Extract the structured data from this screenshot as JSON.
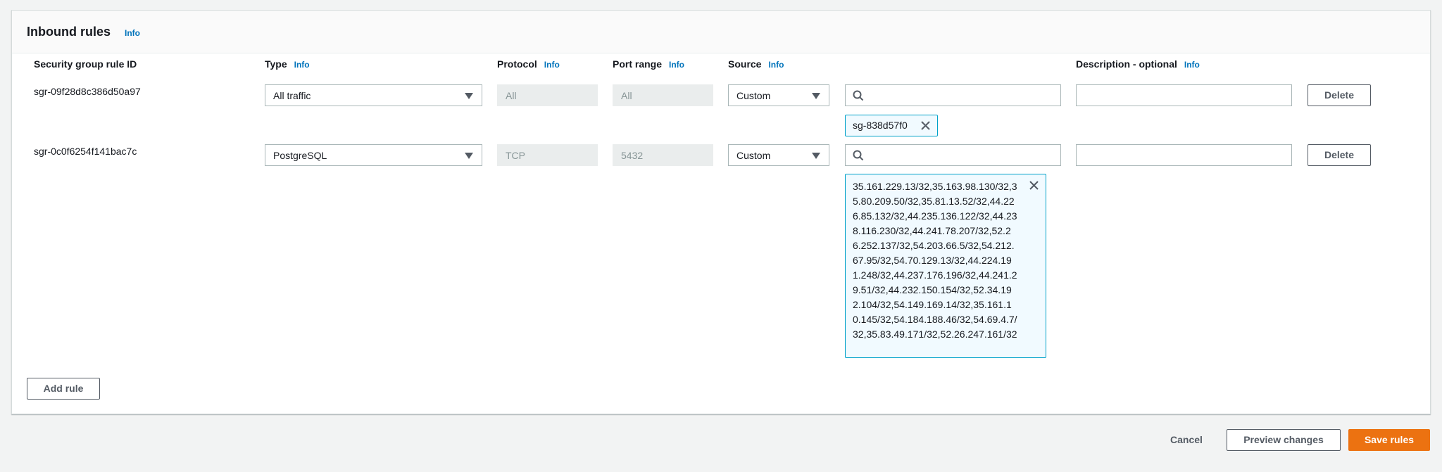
{
  "panel": {
    "title": "Inbound rules",
    "info_label": "Info"
  },
  "columns": [
    {
      "label": "Security group rule ID",
      "info": ""
    },
    {
      "label": "Type",
      "info": "Info"
    },
    {
      "label": "Protocol",
      "info": "Info"
    },
    {
      "label": "Port range",
      "info": "Info"
    },
    {
      "label": "Source",
      "info": "Info"
    },
    {
      "label": "Description - optional",
      "info": "Info"
    }
  ],
  "rules": [
    {
      "id": "sgr-09f28d8c386d50a97",
      "type": "All traffic",
      "protocol": "All",
      "port_range": "All",
      "source_type": "Custom",
      "source_search_value": "",
      "source_tokens": [
        "sg-838d57f0"
      ],
      "description": "",
      "delete_label": "Delete"
    },
    {
      "id": "sgr-0c0f6254f141bac7c",
      "type": "PostgreSQL",
      "protocol": "TCP",
      "port_range": "5432",
      "source_type": "Custom",
      "source_search_value": "",
      "source_tokens": [
        "35.161.229.13/32,35.163.98.130/32,35.80.209.50/32,35.81.13.52/32,44.226.85.132/32,44.235.136.122/32,44.238.116.230/32,44.241.78.207/32,52.26.252.137/32,54.203.66.5/32,54.212.67.95/32,54.70.129.13/32,44.224.191.248/32,44.237.176.196/32,44.241.29.51/32,44.232.150.154/32,52.34.192.104/32,54.149.169.14/32,35.161.10.145/32,54.184.188.46/32,54.69.4.7/32,35.83.49.171/32,52.26.247.161/32"
      ],
      "description": "",
      "delete_label": "Delete"
    }
  ],
  "add_rule_label": "Add rule",
  "footer": {
    "cancel_label": "Cancel",
    "preview_label": "Preview changes",
    "save_label": "Save rules"
  },
  "icons": {
    "search": "search-icon",
    "close": "close-icon",
    "caret": "caret-down-icon"
  },
  "colors": {
    "primary": "#ec7211",
    "link": "#0073bb",
    "token_border": "#00a1c9",
    "token_bg": "#f1faff"
  }
}
